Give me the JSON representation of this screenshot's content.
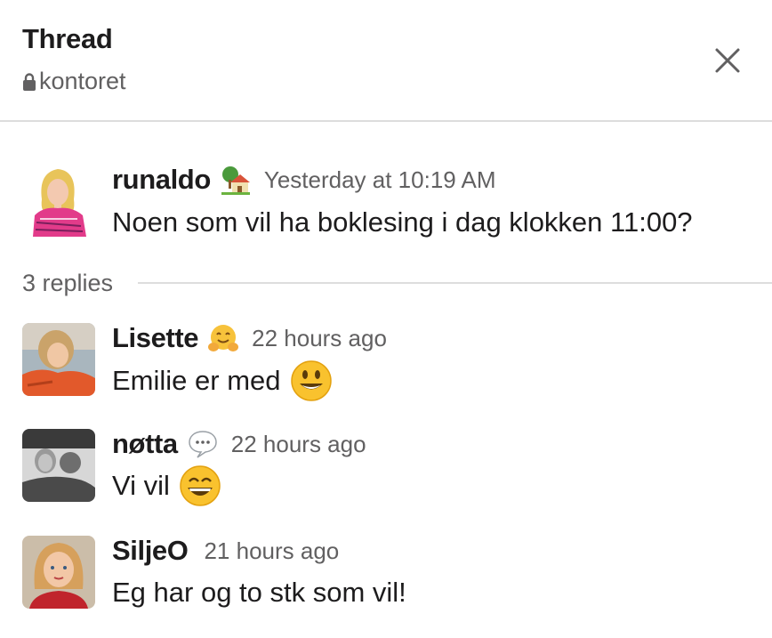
{
  "header": {
    "title": "Thread",
    "channel": "kontoret"
  },
  "parent_message": {
    "author": "runaldo",
    "status_emoji": "house-with-garden",
    "timestamp": "Yesterday at 10:19 AM",
    "text": "Noen som vil ha boklesing i dag klokken 11:00?"
  },
  "replies_label": "3 replies",
  "replies": [
    {
      "author": "Lisette",
      "status_emoji": "hugging-face",
      "timestamp": "22 hours ago",
      "text": "Emilie er med",
      "text_emoji": "smiley"
    },
    {
      "author": "nøtta",
      "status_emoji": "speech-balloon",
      "timestamp": "22 hours ago",
      "text": "Vi vil",
      "text_emoji": "grinning-smile"
    },
    {
      "author": "SiljeO",
      "timestamp": "21 hours ago",
      "text": "Eg har og to stk som vil!"
    }
  ],
  "colors": {
    "text": "#1d1c1d",
    "muted": "#616061",
    "divider": "#dddddd"
  }
}
